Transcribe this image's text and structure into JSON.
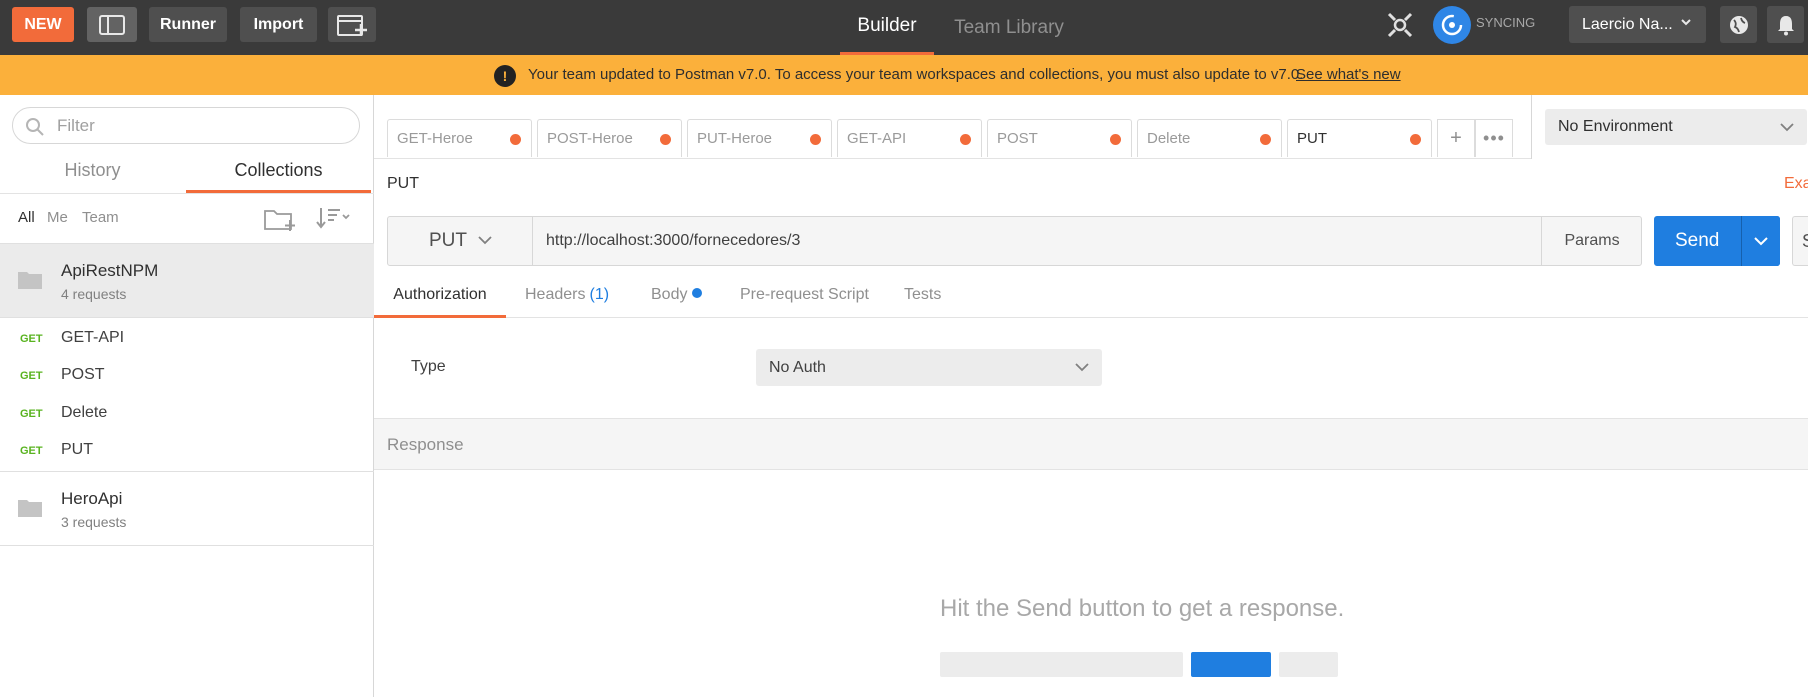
{
  "topbar": {
    "new_label": "NEW",
    "runner_label": "Runner",
    "import_label": "Import",
    "tabs": [
      "Builder",
      "Team Library"
    ],
    "sync_text": "SYNCING",
    "user_name": "Laercio Na...",
    "icons": [
      "sidebar-toggle-icon",
      "new-window-icon",
      "satellite-icon",
      "sync-icon",
      "chevron-down-icon",
      "globe-icon",
      "bell-icon"
    ]
  },
  "banner": {
    "message": "Your team updated to Postman v7.0. To access your team workspaces and collections, you must also update to v7.0.",
    "link": "See what's new",
    "icon": "alert-icon"
  },
  "sidebar": {
    "filter_placeholder": "Filter",
    "tabs": [
      "History",
      "Collections"
    ],
    "active_tab": "Collections",
    "filters": [
      "All",
      "Me",
      "Team"
    ],
    "collections": [
      {
        "name": "ApiRestNPM",
        "count": "4 requests",
        "requests": [
          {
            "method": "GET",
            "name": "GET-API"
          },
          {
            "method": "GET",
            "name": "POST"
          },
          {
            "method": "GET",
            "name": "Delete"
          },
          {
            "method": "GET",
            "name": "PUT"
          }
        ]
      },
      {
        "name": "HeroApi",
        "count": "3 requests"
      }
    ]
  },
  "request_tabs": [
    {
      "label": "GET-Heroe"
    },
    {
      "label": "POST-Heroe"
    },
    {
      "label": "PUT-Heroe"
    },
    {
      "label": "GET-API"
    },
    {
      "label": "POST"
    },
    {
      "label": "Delete"
    },
    {
      "label": "PUT"
    }
  ],
  "environment": {
    "selected": "No Environment"
  },
  "request": {
    "title": "PUT",
    "examples_label": "Exa",
    "method": "PUT",
    "url": "http://localhost:3000/fornecedores/3",
    "params_label": "Params",
    "send_label": "Send",
    "save_label": "S",
    "subtabs": {
      "authorization": "Authorization",
      "headers": "Headers",
      "headers_count": "(1)",
      "body": "Body",
      "prerequest": "Pre-request Script",
      "tests": "Tests"
    },
    "auth": {
      "type_label": "Type",
      "type_value": "No Auth"
    }
  },
  "response": {
    "title": "Response",
    "empty_message": "Hit the Send button to get a response."
  },
  "colors": {
    "accent": "#f26b3a",
    "primary": "#1f7ee0",
    "banner": "#fbb03b",
    "topbar": "#3a3a3a",
    "get_method": "#59b320"
  }
}
